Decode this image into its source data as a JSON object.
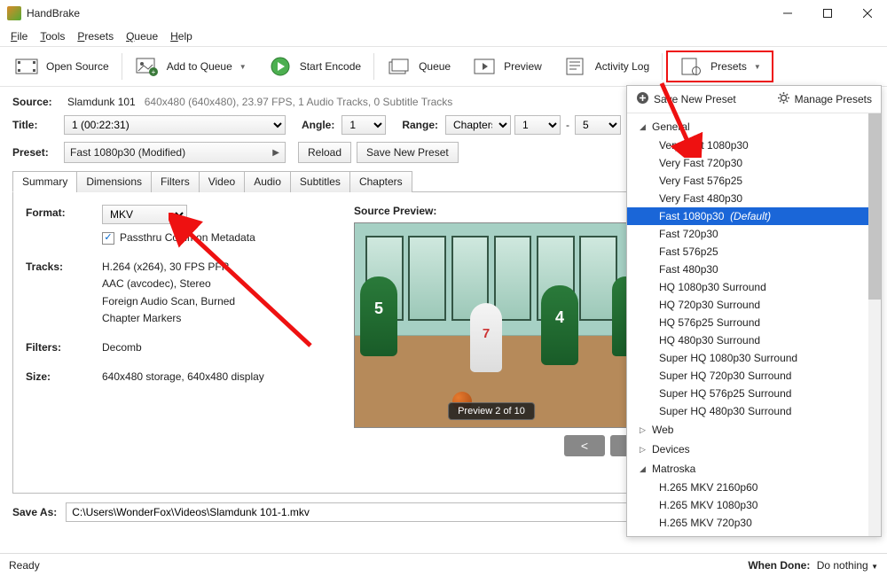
{
  "window": {
    "title": "HandBrake"
  },
  "menu": {
    "file": "File",
    "tools": "Tools",
    "presets": "Presets",
    "queue": "Queue",
    "help": "Help"
  },
  "toolbar": {
    "open_source": "Open Source",
    "add_to_queue": "Add to Queue",
    "start_encode": "Start Encode",
    "queue": "Queue",
    "preview": "Preview",
    "activity_log": "Activity Log",
    "presets": "Presets"
  },
  "source": {
    "label": "Source:",
    "name": "Slamdunk 101",
    "meta": "640x480 (640x480), 23.97 FPS, 1 Audio Tracks, 0 Subtitle Tracks"
  },
  "title": {
    "label": "Title:",
    "value": "1  (00:22:31)"
  },
  "angle": {
    "label": "Angle:",
    "value": "1"
  },
  "range": {
    "label": "Range:",
    "type": "Chapters",
    "from": "1",
    "dash": "-",
    "to": "5"
  },
  "preset": {
    "label": "Preset:",
    "value": "Fast 1080p30  (Modified)",
    "reload": "Reload",
    "save_new": "Save New Preset"
  },
  "tabs": [
    "Summary",
    "Dimensions",
    "Filters",
    "Video",
    "Audio",
    "Subtitles",
    "Chapters"
  ],
  "summary": {
    "format_label": "Format:",
    "format_value": "MKV",
    "passthru": "Passthru Common Metadata",
    "tracks_label": "Tracks:",
    "tracks": [
      "H.264 (x264), 30 FPS PFR",
      "AAC (avcodec), Stereo",
      "Foreign Audio Scan, Burned",
      "Chapter Markers"
    ],
    "filters_label": "Filters:",
    "filters_value": "Decomb",
    "size_label": "Size:",
    "size_value": "640x480 storage, 640x480 display",
    "preview_label": "Source Preview:",
    "preview_badge": "Preview 2 of 10"
  },
  "saveas": {
    "label": "Save As:",
    "path": "C:\\Users\\WonderFox\\Videos\\Slamdunk 101-1.mkv"
  },
  "statusbar": {
    "ready": "Ready",
    "when_done_label": "When Done:",
    "when_done_value": "Do nothing"
  },
  "presets_panel": {
    "save_new": "Save New Preset",
    "manage": "Manage Presets",
    "cats": {
      "general": "General",
      "web": "Web",
      "devices": "Devices",
      "matroska": "Matroska"
    },
    "general_items": [
      "Very Fast 1080p30",
      "Very Fast 720p30",
      "Very Fast 576p25",
      "Very Fast 480p30",
      "Fast 1080p30",
      "Fast 720p30",
      "Fast 576p25",
      "Fast 480p30",
      "HQ 1080p30 Surround",
      "HQ 720p30 Surround",
      "HQ 576p25 Surround",
      "HQ 480p30 Surround",
      "Super HQ 1080p30 Surround",
      "Super HQ 720p30 Surround",
      "Super HQ 576p25 Surround",
      "Super HQ 480p30 Surround"
    ],
    "default_suffix": "(Default)",
    "matroska_items": [
      "H.265 MKV 2160p60",
      "H.265 MKV 1080p30",
      "H.265 MKV 720p30"
    ]
  }
}
